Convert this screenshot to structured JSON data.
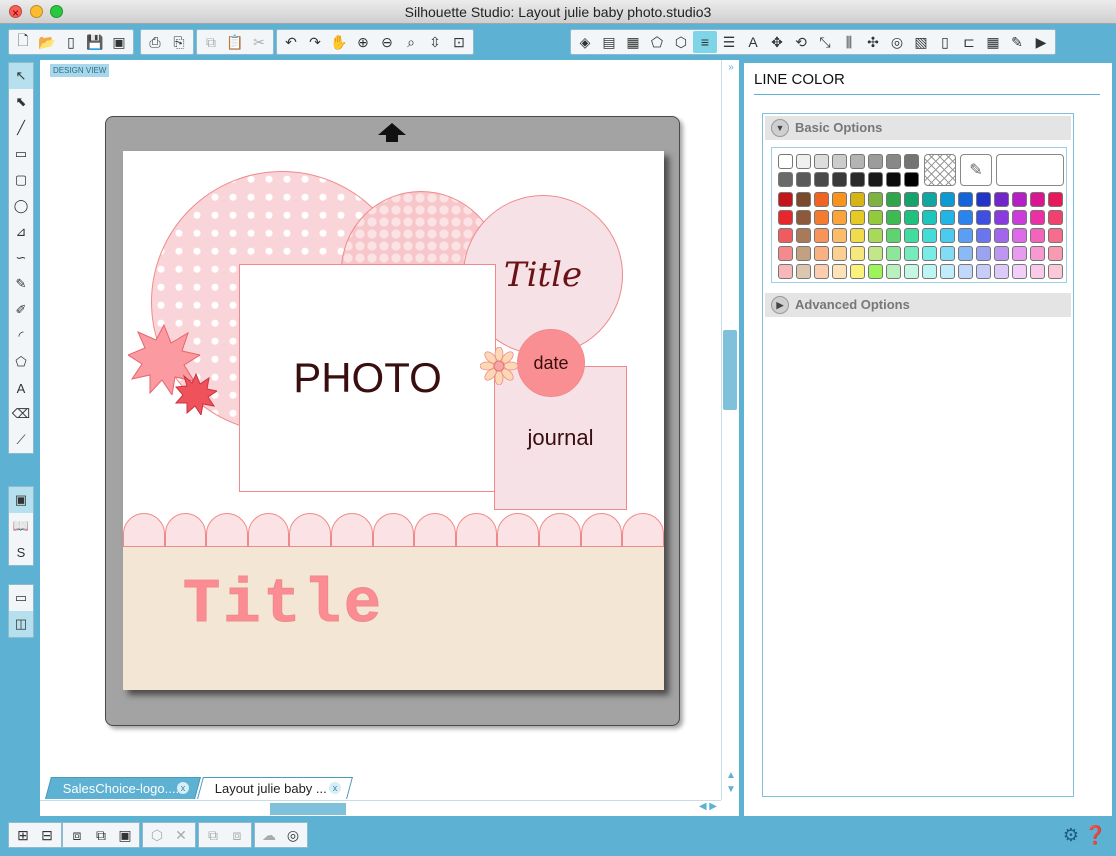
{
  "window": {
    "title": "Silhouette Studio: Layout julie baby photo.studio3"
  },
  "toolbar": {
    "file_tools": [
      {
        "name": "new-icon",
        "glyph": "🗋"
      },
      {
        "name": "open-icon",
        "glyph": "📂"
      },
      {
        "name": "open-library-icon",
        "glyph": "▯"
      },
      {
        "name": "save-icon",
        "glyph": "💾"
      },
      {
        "name": "save-to-library-icon",
        "glyph": "▣"
      }
    ],
    "print_tools": [
      {
        "name": "print-icon",
        "glyph": "⎙"
      },
      {
        "name": "send-to-cutter-icon",
        "glyph": "⎘"
      }
    ],
    "edit_tools": [
      {
        "name": "copy-icon",
        "glyph": "⧉"
      },
      {
        "name": "paste-icon",
        "glyph": "📋"
      },
      {
        "name": "cut-icon",
        "glyph": "✂"
      }
    ],
    "view_tools": [
      {
        "name": "undo-icon",
        "glyph": "↶"
      },
      {
        "name": "redo-icon",
        "glyph": "↷"
      },
      {
        "name": "pan-icon",
        "glyph": "✋"
      },
      {
        "name": "zoom-in-icon",
        "glyph": "⊕"
      },
      {
        "name": "zoom-out-icon",
        "glyph": "⊖"
      },
      {
        "name": "zoom-select-icon",
        "glyph": "⌕"
      },
      {
        "name": "drag-zoom-icon",
        "glyph": "⇳"
      },
      {
        "name": "zoom-fit-icon",
        "glyph": "⊡"
      }
    ],
    "panel_tools": [
      {
        "name": "fill-color-icon",
        "glyph": "◈"
      },
      {
        "name": "gradient-icon",
        "glyph": "▤"
      },
      {
        "name": "fill-pattern-icon",
        "glyph": "▦"
      },
      {
        "name": "shadow-icon",
        "glyph": "⬠"
      },
      {
        "name": "line-color-icon",
        "glyph": "⬡"
      },
      {
        "name": "line-color-active-icon",
        "glyph": "≡"
      },
      {
        "name": "line-style-icon",
        "glyph": "☰"
      },
      {
        "name": "text-style-icon",
        "glyph": "A"
      },
      {
        "name": "transform-icon",
        "glyph": "✥"
      },
      {
        "name": "rotate-icon",
        "glyph": "⟲"
      },
      {
        "name": "scale-icon",
        "glyph": "⤡"
      },
      {
        "name": "align-icon",
        "glyph": "⫼"
      },
      {
        "name": "replicate-icon",
        "glyph": "✣"
      },
      {
        "name": "offset-icon",
        "glyph": "◎"
      },
      {
        "name": "trace-icon",
        "glyph": "▧"
      },
      {
        "name": "page-setup-icon",
        "glyph": "▯"
      },
      {
        "name": "registration-icon",
        "glyph": "⊏"
      },
      {
        "name": "grid-icon",
        "glyph": "▦"
      },
      {
        "name": "cut-settings-icon",
        "glyph": "✎"
      },
      {
        "name": "send-icon",
        "glyph": "▶"
      }
    ]
  },
  "left_tools": [
    {
      "name": "select-tool-icon",
      "glyph": "↖"
    },
    {
      "name": "edit-points-icon",
      "glyph": "⬉"
    },
    {
      "name": "line-tool-icon",
      "glyph": "╱"
    },
    {
      "name": "rectangle-tool-icon",
      "glyph": "▭"
    },
    {
      "name": "rounded-rect-tool-icon",
      "glyph": "▢"
    },
    {
      "name": "ellipse-tool-icon",
      "glyph": "◯"
    },
    {
      "name": "polygon-tool-icon",
      "glyph": "⊿"
    },
    {
      "name": "curve-tool-icon",
      "glyph": "∽"
    },
    {
      "name": "freehand-tool-icon",
      "glyph": "✎"
    },
    {
      "name": "smooth-freehand-icon",
      "glyph": "✐"
    },
    {
      "name": "arc-tool-icon",
      "glyph": "◜"
    },
    {
      "name": "regular-polygon-icon",
      "glyph": "⬠"
    },
    {
      "name": "text-tool-icon",
      "glyph": "A"
    },
    {
      "name": "eraser-tool-icon",
      "glyph": "⌫"
    },
    {
      "name": "knife-tool-icon",
      "glyph": "⟋"
    }
  ],
  "left_tools_lower": [
    {
      "name": "design-page-icon",
      "glyph": "▣"
    },
    {
      "name": "library-icon",
      "glyph": "📖"
    },
    {
      "name": "online-store-icon",
      "glyph": "S"
    }
  ],
  "left_tools_view": [
    {
      "name": "single-view-icon",
      "glyph": "▭"
    },
    {
      "name": "split-view-icon",
      "glyph": "◫"
    }
  ],
  "design": {
    "view_label": "DESIGN VIEW",
    "title_script": "Title",
    "photo": "PHOTO",
    "date": "date",
    "journal": "journal",
    "banner_title": "Title"
  },
  "tabs": [
    {
      "label": "SalesChoice-logo....",
      "close": "x",
      "active": false
    },
    {
      "label": "Layout julie baby ...",
      "close": "x",
      "active": true
    }
  ],
  "panel": {
    "title": "LINE COLOR",
    "basic_options": "Basic Options",
    "advanced_options": "Advanced Options",
    "colors": {
      "grays_row1": [
        "#ffffff",
        "#f0f0f0",
        "#dddddd",
        "#cccccc",
        "#b4b4b4",
        "#9c9c9c",
        "#888888",
        "#747474"
      ],
      "grays_row2": [
        "#6a6a6a",
        "#5a5a5a",
        "#4a4a4a",
        "#3a3a3a",
        "#2a2a2a",
        "#1a1a1a",
        "#0c0c0c",
        "#000000"
      ],
      "palette": [
        [
          "#c2161b",
          "#7a4a2a",
          "#ef6422",
          "#f7941d",
          "#d4b515",
          "#7cb342",
          "#2fa64a",
          "#15a36b",
          "#11a6a2",
          "#0c9ad0",
          "#1665d8",
          "#2334c9",
          "#7126c9",
          "#b520c4",
          "#d9168f",
          "#e6195a"
        ],
        [
          "#e8262c",
          "#8c5a3a",
          "#f47b30",
          "#f9a53c",
          "#e6ca24",
          "#93c93d",
          "#3dba52",
          "#1ec27f",
          "#1cc6bd",
          "#21b5e6",
          "#2b84ee",
          "#3f4fe0",
          "#8a3be0",
          "#cc3bdc",
          "#ec2fa4",
          "#f0416f"
        ],
        [
          "#ef5b5f",
          "#a87a5a",
          "#f7945a",
          "#fbbd6a",
          "#f0dc4c",
          "#a8d95a",
          "#5fd46e",
          "#42dca0",
          "#44dcd6",
          "#4ccaf0",
          "#5a9ff3",
          "#6a76ec",
          "#a266ec",
          "#dd6be8",
          "#f364bd",
          "#f56c8c"
        ],
        [
          "#f48a8c",
          "#c2a080",
          "#f9b184",
          "#fcd190",
          "#f6e87c",
          "#c2e78a",
          "#8ee69a",
          "#76ecbe",
          "#7aece8",
          "#82dcf5",
          "#8ab9f6",
          "#9aa2f2",
          "#bd96f2",
          "#e89cf0",
          "#f79ad2",
          "#f89ab0"
        ],
        [
          "#f8b8ba",
          "#dcc6b0",
          "#fccdb0",
          "#fde3b8",
          "#fbf27c",
          "#9cf35a",
          "#b8f0c0",
          "#c6f6e4",
          "#bdf4f4",
          "#c0ecfb",
          "#c2d8fb",
          "#c8ccf8",
          "#dccaf8",
          "#f2cef8",
          "#facaea",
          "#fac8d6"
        ]
      ]
    }
  }
}
